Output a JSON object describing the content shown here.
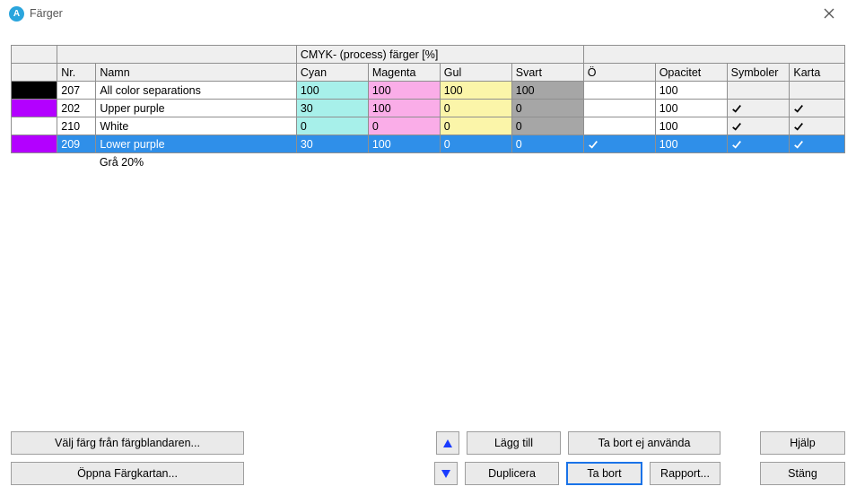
{
  "window": {
    "title": "Färger"
  },
  "table": {
    "group_header": "CMYK- (process) färger [%]",
    "headers": {
      "nr": "Nr.",
      "namn": "Namn",
      "cyan": "Cyan",
      "magenta": "Magenta",
      "gul": "Gul",
      "svart": "Svart",
      "o": "Ö",
      "opacitet": "Opacitet",
      "symboler": "Symboler",
      "karta": "Karta"
    },
    "rows": [
      {
        "swatch": "#000000",
        "nr": "207",
        "namn": "All color separations",
        "cyan": "100",
        "magenta": "100",
        "gul": "100",
        "svart": "100",
        "o_check": false,
        "opacitet": "100",
        "symboler": false,
        "karta": false,
        "selected": false
      },
      {
        "swatch": "#b300ff",
        "nr": "202",
        "namn": "Upper purple",
        "cyan": "30",
        "magenta": "100",
        "gul": "0",
        "svart": "0",
        "o_check": false,
        "opacitet": "100",
        "symboler": true,
        "karta": true,
        "selected": false
      },
      {
        "swatch": "#ffffff",
        "nr": "210",
        "namn": "White",
        "cyan": "0",
        "magenta": "0",
        "gul": "0",
        "svart": "0",
        "o_check": false,
        "opacitet": "100",
        "symboler": true,
        "karta": true,
        "selected": false
      },
      {
        "swatch": "#b300ff",
        "nr": "209",
        "namn": "Lower purple",
        "cyan": "30",
        "magenta": "100",
        "gul": "0",
        "svart": "0",
        "o_check": true,
        "opacitet": "100",
        "symboler": true,
        "karta": true,
        "selected": true
      }
    ],
    "footer_label": "Grå 20%"
  },
  "buttons": {
    "pick_color": "Välj färg från färgblandaren...",
    "open_chart": "Öppna Färgkartan...",
    "add": "Lägg till",
    "remove_unused": "Ta bort ej använda",
    "help": "Hjälp",
    "duplicate": "Duplicera",
    "remove": "Ta bort",
    "report": "Rapport...",
    "close": "Stäng"
  }
}
